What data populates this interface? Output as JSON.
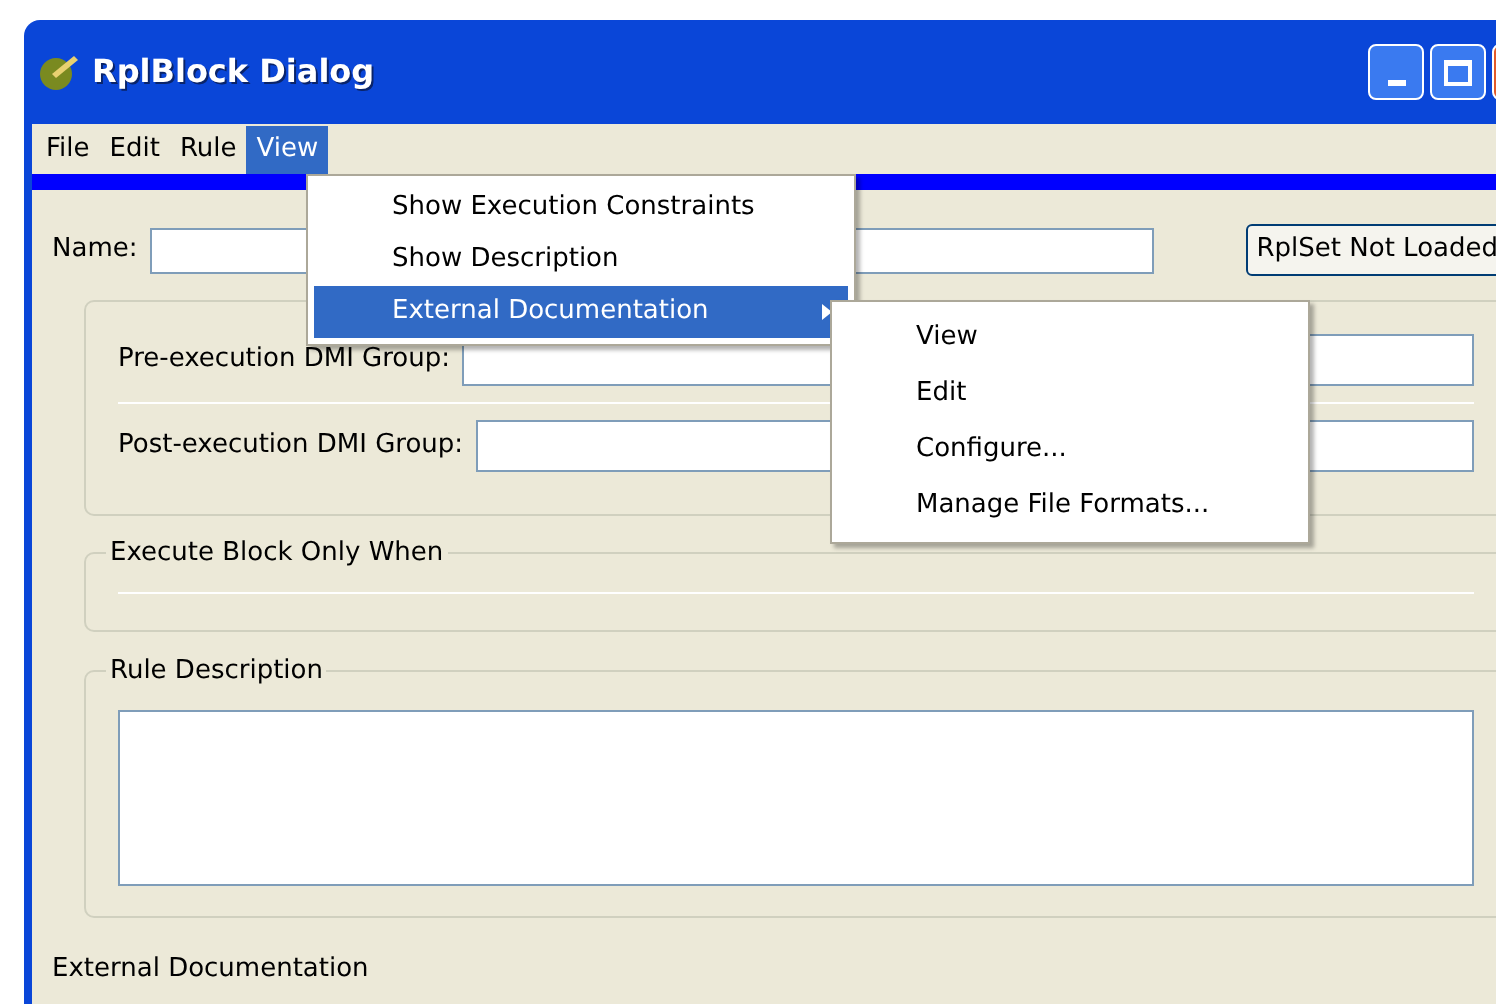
{
  "window": {
    "title": "RplBlock Dialog"
  },
  "menu_bar": [
    {
      "label": "File",
      "selected": false
    },
    {
      "label": "Edit",
      "selected": false
    },
    {
      "label": "Rule",
      "selected": false
    },
    {
      "label": "View",
      "selected": true
    }
  ],
  "view_menu": [
    {
      "label": "Show Execution Constraints",
      "selected": false,
      "submenu": false
    },
    {
      "label": "Show Description",
      "selected": false,
      "submenu": false
    },
    {
      "label": "External Documentation",
      "selected": true,
      "submenu": true
    }
  ],
  "submenu": [
    {
      "label": "View"
    },
    {
      "label": "Edit"
    },
    {
      "label": "Configure..."
    },
    {
      "label": "Manage File Formats..."
    }
  ],
  "name_label": "Name:",
  "rplset_button": "RplSet Not Loaded",
  "dmi_groups": [
    {
      "label": "Pre-execution DMI Group:"
    },
    {
      "label": "Post-execution DMI Group:"
    }
  ],
  "execute_group": {
    "title": "Execute Block Only When"
  },
  "rule_description": {
    "title": "Rule Description"
  },
  "footer": "External Documentation"
}
